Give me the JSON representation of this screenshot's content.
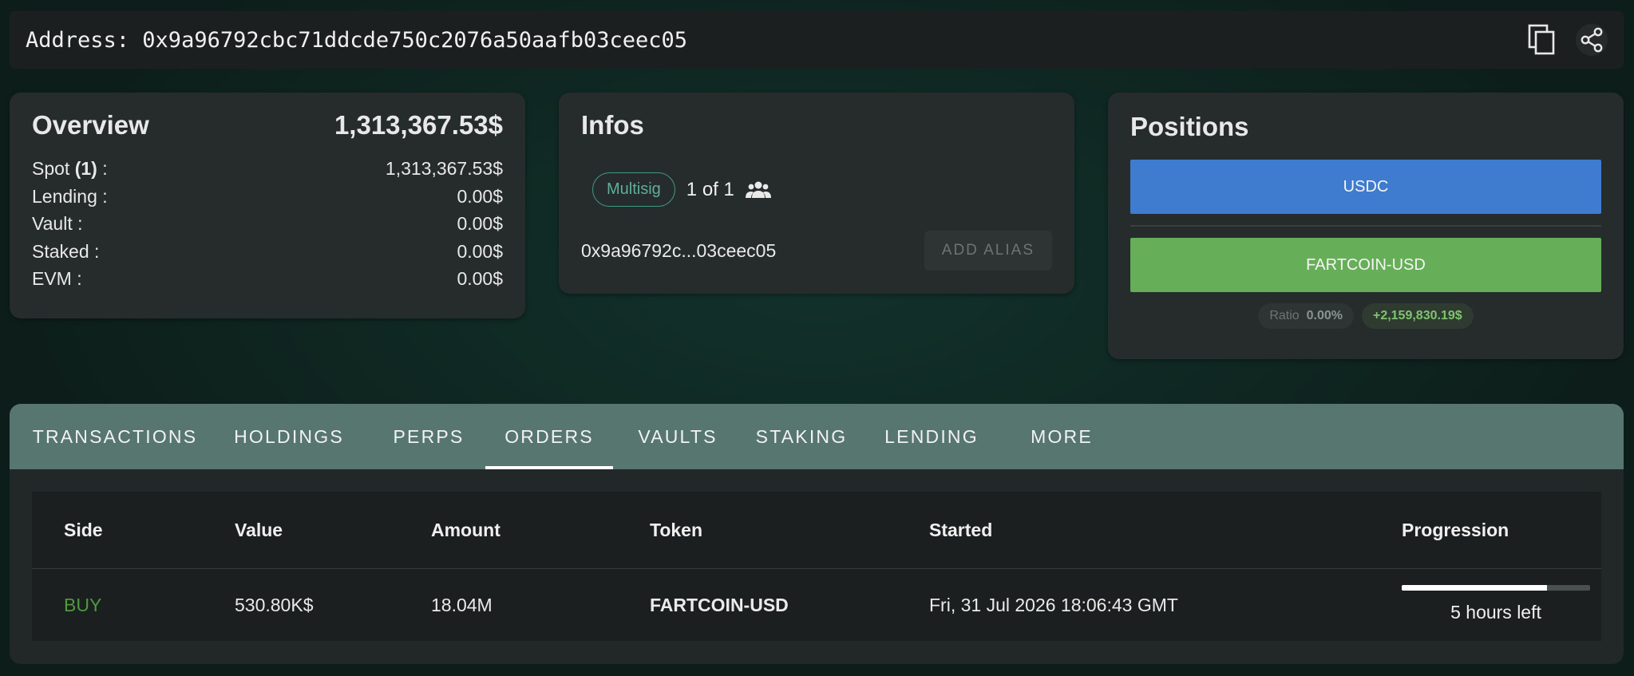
{
  "address_bar": {
    "label": "Address: 0x9a96792cbc71ddcde750c2076a50aafb03ceec05",
    "copy_icon": "copy-icon",
    "share_icon": "share-icon"
  },
  "overview": {
    "title": "Overview",
    "total": "1,313,367.53$",
    "rows": [
      {
        "label": "Spot ",
        "count": "(1)",
        "suffix": " :",
        "value": "1,313,367.53$"
      },
      {
        "label": "Lending :",
        "value": "0.00$"
      },
      {
        "label": "Vault :",
        "value": "0.00$"
      },
      {
        "label": "Staked :",
        "value": "0.00$"
      },
      {
        "label": "EVM :",
        "value": "0.00$"
      }
    ]
  },
  "infos": {
    "title": "Infos",
    "type_chip": "Multisig",
    "signers": "1 of 1",
    "signers_icon": "group-icon",
    "short_address": "0x9a96792c...03ceec05",
    "add_alias_label": "ADD ALIAS"
  },
  "positions": {
    "title": "Positions",
    "bars": [
      {
        "label": "USDC",
        "color": "#3f7ccf"
      },
      {
        "label": "FARTCOIN-USD",
        "color": "#66ae58"
      }
    ],
    "ratio_label": "Ratio",
    "ratio_value": "0.00%",
    "pnl": "+2,159,830.19$"
  },
  "tabs": [
    {
      "label": "TRANSACTIONS"
    },
    {
      "label": "HOLDINGS"
    },
    {
      "label": "PERPS"
    },
    {
      "label": "ORDERS",
      "active": true
    },
    {
      "label": "VAULTS"
    },
    {
      "label": "STAKING"
    },
    {
      "label": "LENDING"
    },
    {
      "label": "MORE"
    }
  ],
  "orders_table": {
    "headers": [
      "Side",
      "Value",
      "Amount",
      "Token",
      "Started",
      "Progression"
    ],
    "rows": [
      {
        "side": "BUY",
        "value": "530.80K$",
        "amount": "18.04M",
        "token": "FARTCOIN-USD",
        "started": "Fri, 31 Jul 2026 18:06:43 GMT",
        "progress": 0.77,
        "progress_text": "5 hours left"
      }
    ]
  },
  "colors": {
    "buy": "#4d9a3f",
    "tab_bar": "#577670",
    "multisig_chip": "#3e9a86"
  }
}
